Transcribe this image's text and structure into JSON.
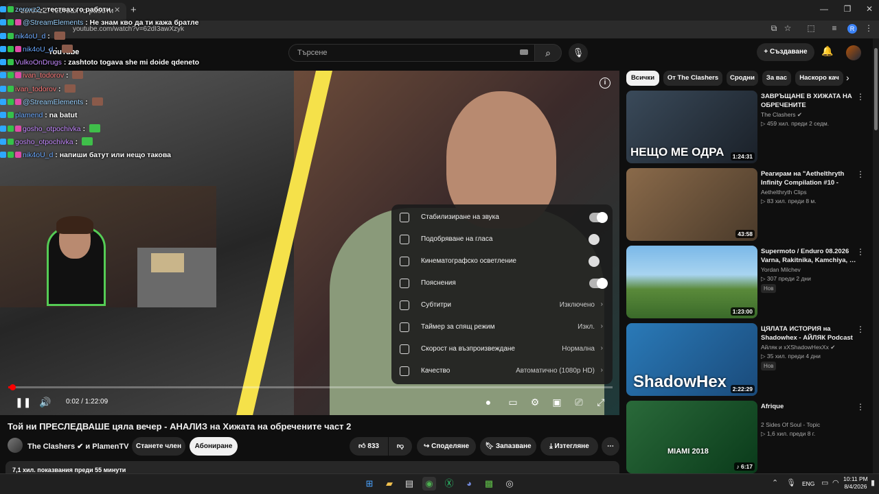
{
  "browser": {
    "tab_title": "zeroxz2: тествах го работи",
    "url": "youtube.com/watch?v=62dI3awXzyk",
    "profile_initial": "R"
  },
  "youtube": {
    "logo_text": "YouTube",
    "search_placeholder": "Търсене",
    "create_label": "Създаване"
  },
  "chat": [
    {
      "user": "zeroxz2",
      "message": "тествах го работи",
      "user_color": "#9ad2ff",
      "emote": false
    },
    {
      "user": "@StreamElements",
      "message": "Не знам кво да ти кажа братле",
      "user_color": "#9ad2ff",
      "emote": false
    },
    {
      "user": "nik4oU_d",
      "message": "",
      "user_color": "#6aa9ff",
      "emote": true
    },
    {
      "user": "nik4oU_d",
      "message": "",
      "user_color": "#6aa9ff",
      "emote": true
    },
    {
      "user": "VulkoOnDrugs",
      "message": "zashtoto togava she mi doide qdeneto",
      "user_color": "#c58aff",
      "emote": false
    },
    {
      "user": "ivan_todorov",
      "message": "",
      "user_color": "#ff7a7a",
      "emote": true
    },
    {
      "user": "ivan_todorov",
      "message": "",
      "user_color": "#ff7a7a",
      "emote": true
    },
    {
      "user": "@StreamElements",
      "message": "",
      "user_color": "#9ad2ff",
      "emote": true
    },
    {
      "user": "plamend",
      "message": "na batut",
      "user_color": "#6aa9ff",
      "emote": false
    },
    {
      "user": "gosho_otpochivka",
      "message": "",
      "user_color": "#c58aff",
      "emote": true
    },
    {
      "user": "gosho_otpochivka",
      "message": "",
      "user_color": "#c58aff",
      "emote": true
    },
    {
      "user": "nik4oU_d",
      "message": "напиши батут или нещо такова",
      "user_color": "#6aa9ff",
      "emote": false
    }
  ],
  "settings_menu": [
    {
      "icon": "audio-stabilize-icon",
      "label": "Стабилизиране на звука",
      "value": "",
      "toggle": "on"
    },
    {
      "icon": "voice-boost-icon",
      "label": "Подобряване на гласа",
      "value": "",
      "toggle": "off"
    },
    {
      "icon": "cinematic-lighting-icon",
      "label": "Кинематографско осветление",
      "value": "",
      "toggle": "off"
    },
    {
      "icon": "annotations-icon",
      "label": "Пояснения",
      "value": "",
      "toggle": "on"
    },
    {
      "icon": "subtitles-icon",
      "label": "Субтитри",
      "value": "Изключено",
      "toggle": ""
    },
    {
      "icon": "sleep-timer-icon",
      "label": "Таймер за спящ режим",
      "value": "Изкл.",
      "toggle": ""
    },
    {
      "icon": "playback-speed-icon",
      "label": "Скорост на възпроизвеждане",
      "value": "Нормална",
      "toggle": ""
    },
    {
      "icon": "quality-icon",
      "label": "Качество",
      "value": "Автоматично (1080p HD)",
      "toggle": ""
    }
  ],
  "player": {
    "time": "0:02 / 1:22:09",
    "progress_fraction": 0.0004
  },
  "video": {
    "title": "Той ни ПРЕСЛЕДВАШЕ цяла вечер - АНАЛИЗ на Хижата на обречените част 2",
    "channel": "The Clashers ✔ и PlamenTV",
    "join_label": "Станете член",
    "subscribe_label": "Абониране",
    "likes": "833",
    "share_label": "Споделяне",
    "save_label": "Запазване",
    "download_label": "Изтегляне",
    "description_preview": "7,1 хил. показвания  преди 55 минути"
  },
  "chips": [
    {
      "label": "Всички",
      "active": true
    },
    {
      "label": "От The Clashers",
      "active": false
    },
    {
      "label": "Сродни",
      "active": false
    },
    {
      "label": "За вас",
      "active": false
    },
    {
      "label": "Наскоро кач",
      "active": false
    }
  ],
  "recommendations": [
    {
      "title": "ЗАВРЪЩАНЕ В ХИЖАТА НА ОБРЕЧЕНИТЕ",
      "channel": "The Clashers ✔",
      "meta": "▷ 459 хил.  преди 2 седм.",
      "duration": "1:24:31",
      "badge": "",
      "thumb_text": "НЕЩО МЕ ОДРА",
      "thumb_bg": "linear-gradient(135deg,#3a4a5a,#1a2028)"
    },
    {
      "title": "Реагирам на \"Aethelthryth Infinity Compilation #10 - Best…",
      "channel": "Aethelthryth Clips",
      "meta": "▷ 83 хил.  преди 8 м.",
      "duration": "43:58",
      "badge": "",
      "thumb_text": "",
      "thumb_bg": "linear-gradient(135deg,#8a6a4a,#4a3a2a)"
    },
    {
      "title": "Supermoto / Enduro 08.2026 Varna, Rakitnika, Kamchiya, …",
      "channel": "Yordan Milchev",
      "meta": "▷ 307  преди 2 дни",
      "duration": "1:23:00",
      "badge": "Нов",
      "thumb_text": "",
      "thumb_bg": "linear-gradient(180deg,#7ab8e8 0%,#a8d4f0 40%,#5a8a3a 60%,#3a6a2a 100%)"
    },
    {
      "title": "ЦЯЛАТА ИСТОРИЯ на Shadowhex - АЙЛЯК Podcast …",
      "channel": "Айляк и xXShadowHexXx ✔",
      "meta": "▷ 35 хил.  преди 4 дни",
      "duration": "2:22:29",
      "badge": "Нов",
      "thumb_text": "ShadowHex",
      "thumb_bg": "linear-gradient(135deg,#2a7ab8,#1a4a7a)"
    },
    {
      "title": "Afrique",
      "channel": "2 Sides Of Soul - Topic",
      "meta": "▷ 1,6 хил.  преди 8 г.",
      "duration": "♪ 6:17",
      "badge": "",
      "thumb_text": "MIAMI 2018",
      "thumb_bg": "linear-gradient(135deg,#2a6a3a,#0a3a1a)"
    }
  ],
  "taskbar": {
    "lang": "ENG",
    "time": "10:11 PM",
    "date": "8/4/2026"
  }
}
